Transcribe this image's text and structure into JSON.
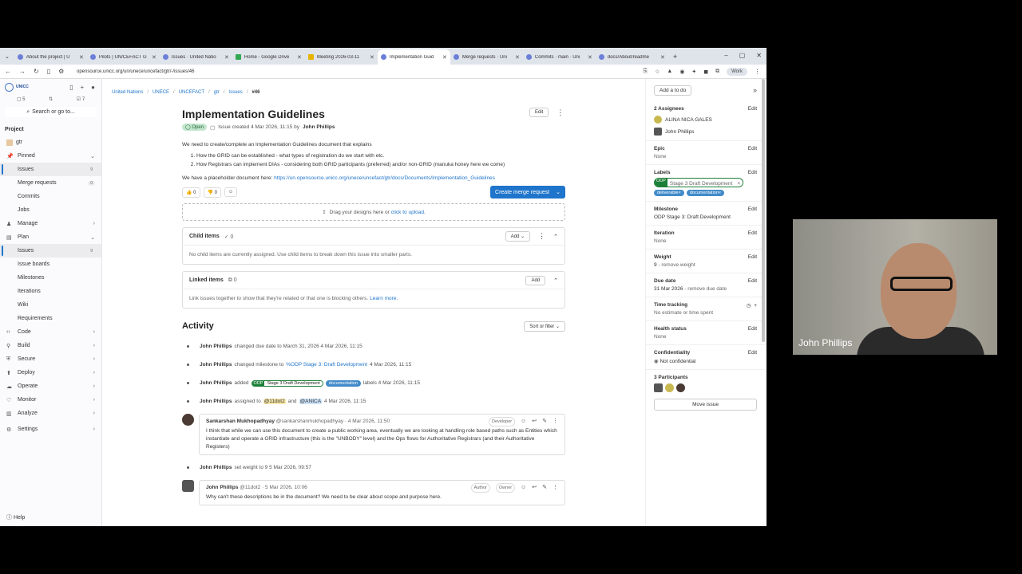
{
  "tabs": [
    {
      "label": "About the project | U"
    },
    {
      "label": "Pilots | UN/CEFACT G"
    },
    {
      "label": "Issues · United Natio"
    },
    {
      "label": "Home - Google Drive"
    },
    {
      "label": "Meeting 2026-03-11"
    },
    {
      "label": "Implementation Guid"
    },
    {
      "label": "Merge requests · Uni"
    },
    {
      "label": "Commits · main · Uni"
    },
    {
      "label": "docs/About/readme"
    }
  ],
  "address": {
    "url": "opensource.unicc.org/un/unece/uncefact/gtr/-/issues/46",
    "profile": "Work"
  },
  "sidebar": {
    "logo": "UNICC",
    "counts": [
      "5",
      "",
      "7"
    ],
    "search": "Search or go to...",
    "project_label": "Project",
    "project_name": "gtr",
    "items": [
      {
        "label": "Pinned"
      },
      {
        "label": "Issues",
        "badge": "9"
      },
      {
        "label": "Merge requests",
        "badge": "0"
      },
      {
        "label": "Commits"
      },
      {
        "label": "Jobs"
      },
      {
        "label": "Manage"
      },
      {
        "label": "Plan"
      },
      {
        "label": "Issues",
        "badge": "9"
      },
      {
        "label": "Issue boards"
      },
      {
        "label": "Milestones"
      },
      {
        "label": "Iterations"
      },
      {
        "label": "Wiki"
      },
      {
        "label": "Requirements"
      },
      {
        "label": "Code"
      },
      {
        "label": "Build"
      },
      {
        "label": "Secure"
      },
      {
        "label": "Deploy"
      },
      {
        "label": "Operate"
      },
      {
        "label": "Monitor"
      },
      {
        "label": "Analyze"
      },
      {
        "label": "Settings"
      }
    ],
    "help": "Help"
  },
  "breadcrumb": [
    "United Nations",
    "UNECE",
    "UNCEFACT",
    "gtr",
    "Issues",
    "#46"
  ],
  "issue": {
    "title": "Implementation Guidelines",
    "edit": "Edit",
    "status": "Open",
    "created": "Issue created 4 Mar 2026, 11:15 by",
    "author": "John Phillips",
    "desc_intro": "We need to create/complete an Implementation Guidelines document that explains",
    "desc_items": [
      "How the GRID can be established - what types of registration do we start with etc.",
      "How Registrars can implement DIAs - considering both GRID participants (preferred) and/or non-GRID (manuka honey here we come)"
    ],
    "placeholder_text": "We have a placeholder document here:",
    "placeholder_link": "https://un.opensource.unicc.org/unece/uncefact/gtr/docs/Documents/Implementation_Guidelines",
    "thumbs_up": "0",
    "thumbs_down": "0",
    "create_mr": "Create merge request",
    "drop_text": "Drag your designs here or",
    "drop_link": "click to upload."
  },
  "child_items": {
    "title": "Child items",
    "count": "0",
    "add": "Add",
    "empty": "No child items are currently assigned. Use child items to break down this issue into smaller parts."
  },
  "linked_items": {
    "title": "Linked items",
    "count": "0",
    "add": "Add",
    "empty": "Link issues together to show that they're related or that one is blocking others.",
    "learn": "Learn more."
  },
  "activity": {
    "title": "Activity",
    "sort": "Sort or filter",
    "events": [
      {
        "who": "John Phillips",
        "text": "changed due date to March 31, 2026 4 Mar 2026, 11:15"
      },
      {
        "who": "John Phillips",
        "text": "changed milestone to",
        "link": "%ODP Stage 3: Draft Development",
        "time": "4 Mar 2026, 11:15"
      },
      {
        "who": "John Phillips",
        "text": "added",
        "time": "labels 4 Mar 2026, 11:15"
      },
      {
        "who": "John Phillips",
        "text": "assigned to",
        "m1": "@11dot2",
        "and": "and",
        "m2": "@ANICA",
        "time": "4 Mar 2026, 11:15"
      }
    ],
    "note1": {
      "name": "Sankarshan Mukhopadhyay",
      "user": "@sankarshanmukhopadhyay · 4 Mar 2026, 11:50",
      "role": "Developer",
      "body": "I think that while we can use this document to create a public working area, eventually we are looking at handling role based paths such as Entities which instantiate and operate a GRID infrastructure (this is the \"UNBODY\" level) and the Ops flows for Authoritative Registrars (and their Authoritative Registers)"
    },
    "weight_event": {
      "who": "John Phillips",
      "text": "set weight to 9 5 Mar 2026, 09:57"
    },
    "note2": {
      "name": "John Phillips",
      "user": "@11dot2 · 5 Mar 2026, 10:06",
      "role1": "Author",
      "role2": "Owner",
      "body": "Why can't these descriptions be in the document? We need to be clear about scope and purpose here."
    }
  },
  "labels": {
    "odp_key": "ODP",
    "odp_val": "Stage 3 Draft Development",
    "deliverable": "deliverable",
    "documentation": "documentation"
  },
  "right": {
    "todo": "Add a to do",
    "assignees_title": "2 Assignees",
    "assignees": [
      "ALINA NICA GALES",
      "John Phillips"
    ],
    "epic_title": "Epic",
    "epic_val": "None",
    "labels_title": "Labels",
    "milestone_title": "Milestone",
    "milestone_val": "ODP Stage 3: Draft Development",
    "iteration_title": "Iteration",
    "iteration_val": "None",
    "weight_title": "Weight",
    "weight_val": "9",
    "weight_remove": "- remove weight",
    "due_title": "Due date",
    "due_val": "31 Mar 2026",
    "due_remove": "- remove due date",
    "time_title": "Time tracking",
    "time_val": "No estimate or time spent",
    "health_title": "Health status",
    "health_val": "None",
    "conf_title": "Confidentiality",
    "conf_val": "Not confidential",
    "participants_title": "3 Participants",
    "move": "Move issue",
    "edit": "Edit"
  },
  "webcam": {
    "name": "John Phillips"
  }
}
